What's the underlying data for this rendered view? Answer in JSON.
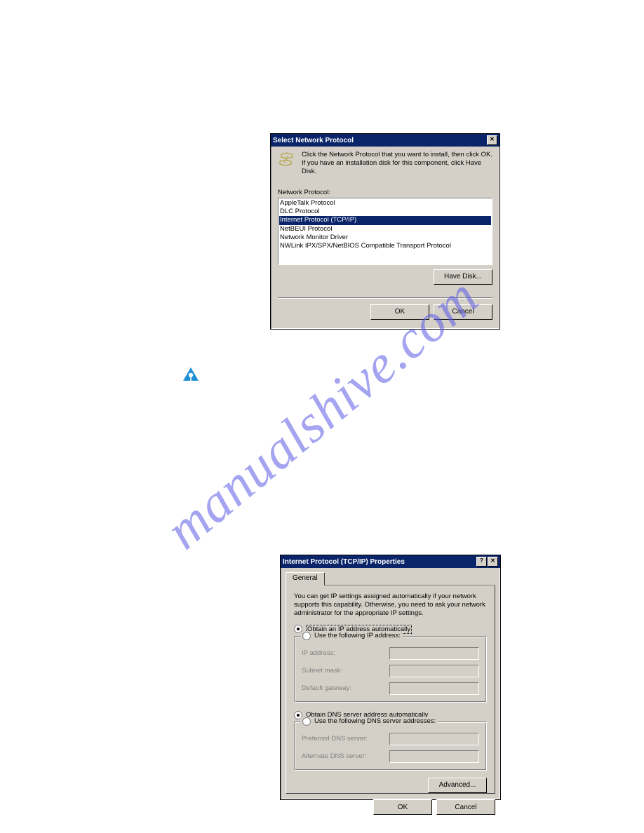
{
  "watermark": "manualshive.com",
  "dialog1": {
    "title": "Select Network Protocol",
    "close_glyph": "✕",
    "instruction": "Click the Network Protocol that you want to install, then click OK. If you have an installation disk for this component, click Have Disk.",
    "list_label": "Network Protocol:",
    "items": {
      "i0": "AppleTalk Protocol",
      "i1": "DLC Protocol",
      "i2": "Internet Protocol (TCP/IP)",
      "i3": "NetBEUI Protocol",
      "i4": "Network Monitor Driver",
      "i5": "NWLink IPX/SPX/NetBIOS Compatible Transport Protocol"
    },
    "have_disk": "Have Disk...",
    "ok": "OK",
    "cancel": "Cancel"
  },
  "dialog2": {
    "title": "Internet Protocol (TCP/IP) Properties",
    "help_glyph": "?",
    "close_glyph": "✕",
    "tab_general": "General",
    "paragraph": "You can get IP settings assigned automatically if your network supports this capability. Otherwise, you need to ask your network administrator for the appropriate IP settings.",
    "radio_obtain_ip": "Obtain an IP address automatically",
    "radio_use_ip": "Use the following IP address:",
    "lbl_ip": "IP address:",
    "lbl_subnet": "Subnet mask:",
    "lbl_gateway": "Default gateway:",
    "radio_obtain_dns": "Obtain DNS server address automatically",
    "radio_use_dns": "Use the following DNS server addresses:",
    "lbl_pref_dns": "Preferred DNS server:",
    "lbl_alt_dns": "Alternate DNS server:",
    "advanced": "Advanced...",
    "ok": "OK",
    "cancel": "Cancel"
  }
}
